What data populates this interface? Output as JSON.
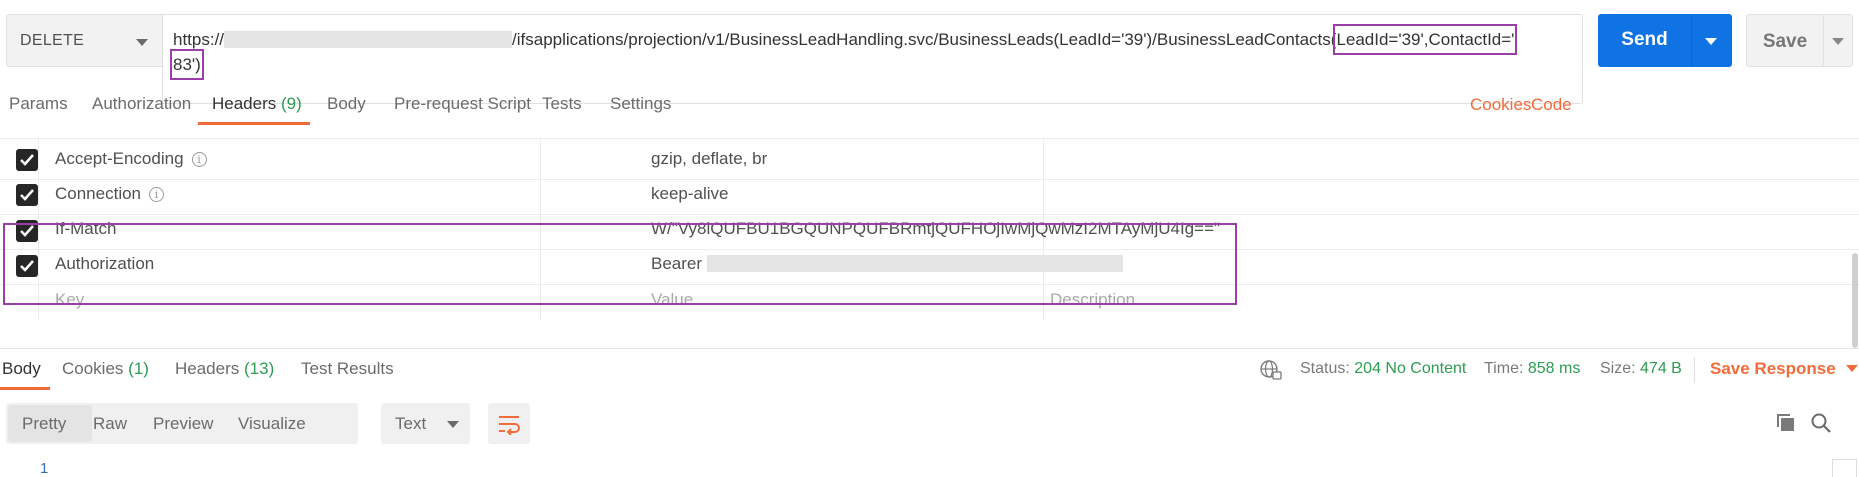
{
  "request": {
    "method": "DELETE",
    "url_prefix": "https://",
    "url_main": "/ifsapplications/projection/v1/BusinessLeadHandling.svc/BusinessLeads(LeadId='39')/BusinessLeadContacts(",
    "url_highlight_1": "LeadId='39',ContactId='",
    "url_highlight_2": "83')",
    "send_label": "Send",
    "save_label": "Save"
  },
  "request_tabs": [
    {
      "label": "Params"
    },
    {
      "label": "Authorization"
    },
    {
      "label": "Headers",
      "count": "(9)"
    },
    {
      "label": "Body"
    },
    {
      "label": "Pre-request Script"
    },
    {
      "label": "Tests"
    },
    {
      "label": "Settings"
    }
  ],
  "right_links": {
    "cookies": "Cookies",
    "code": "Code"
  },
  "headers": [
    {
      "key": "Accept-Encoding",
      "value": "gzip, deflate, br",
      "checked": true,
      "info": true
    },
    {
      "key": "Connection",
      "value": "keep-alive",
      "checked": true,
      "info": true
    },
    {
      "key": "If-Match",
      "value": "W/\"Vy8iQUFBU1BGQUNPQUFBRmtjQUFHOjIwMjQwMzI2MTAyMjU4Ig==\"",
      "checked": true,
      "info": false
    },
    {
      "key": "Authorization",
      "value": "Bearer",
      "checked": true,
      "info": false
    }
  ],
  "new_row": {
    "key_placeholder": "Key",
    "value_placeholder": "Value",
    "description_placeholder": "Description"
  },
  "response_tabs": [
    {
      "label": "Body"
    },
    {
      "label": "Cookies",
      "count": "(1)"
    },
    {
      "label": "Headers",
      "count": "(13)"
    },
    {
      "label": "Test Results"
    }
  ],
  "status": {
    "status_label": "Status:",
    "status_value": "204 No Content",
    "time_label": "Time:",
    "time_value": "858 ms",
    "size_label": "Size:",
    "size_value": "474 B",
    "save_response": "Save Response"
  },
  "view_modes": [
    "Pretty",
    "Raw",
    "Preview",
    "Visualize"
  ],
  "format": "Text",
  "line_number": "1",
  "colors": {
    "accent": "#f26b3a",
    "send": "#0f73e4",
    "highlight": "#9b3fa8",
    "success": "#2e9c52"
  }
}
